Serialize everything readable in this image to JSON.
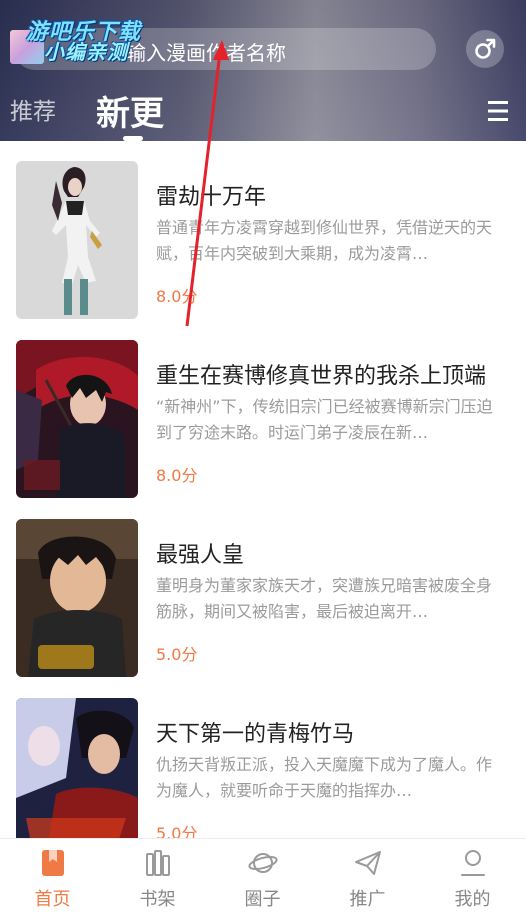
{
  "watermark": {
    "line1": "游吧乐下载",
    "line2": "小编亲测"
  },
  "search": {
    "placeholder": "输入漫画作者名称",
    "icon": "search-icon"
  },
  "header": {
    "gender_icon": "male-symbol-icon",
    "menu_icon": "menu-icon",
    "tabs": [
      {
        "label": "推荐",
        "active": false
      },
      {
        "label": "新更",
        "active": true
      }
    ]
  },
  "comics": [
    {
      "title": "雷劫十万年",
      "description": "普通青年方凌霄穿越到修仙世界，凭借逆天的天赋，百年内突破到大乘期，成为凌霄…",
      "score": "8.0分"
    },
    {
      "title": "重生在赛博修真世界的我杀上顶端",
      "description": "“新神州”下，传统旧宗门已经被赛博新宗门压迫到了穷途末路。时运门弟子凌辰在新…",
      "score": "8.0分"
    },
    {
      "title": "最强人皇",
      "description": "董明身为董家家族天才，突遭族兄暗害被废全身筋脉，期间又被陷害，最后被迫离开…",
      "score": "5.0分"
    },
    {
      "title": "天下第一的青梅竹马",
      "description": "仇扬天背叛正派，投入天魔魔下成为了魔人。作为魔人，就要听命于天魔的指挥办…",
      "score": "5.0分"
    }
  ],
  "bottom_nav": [
    {
      "label": "首页",
      "icon": "bookmark-icon",
      "active": true
    },
    {
      "label": "书架",
      "icon": "bookshelf-icon",
      "active": false
    },
    {
      "label": "圈子",
      "icon": "planet-icon",
      "active": false
    },
    {
      "label": "推广",
      "icon": "paper-plane-icon",
      "active": false
    },
    {
      "label": "我的",
      "icon": "user-icon",
      "active": false
    }
  ],
  "colors": {
    "accent": "#f07a45",
    "annotation_arrow": "#e5212b"
  }
}
